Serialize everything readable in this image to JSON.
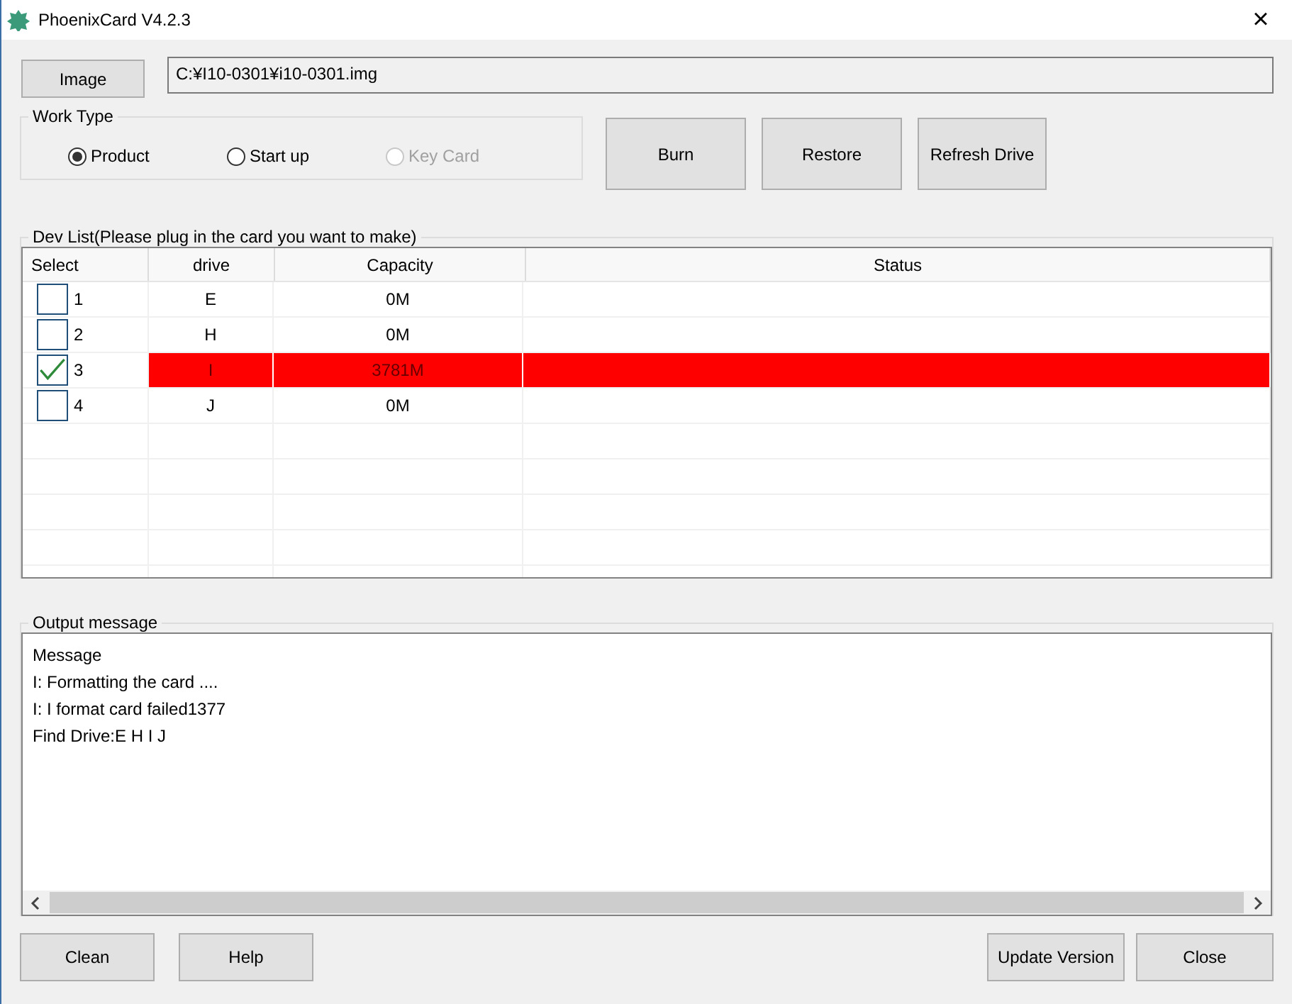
{
  "window": {
    "title": "PhoenixCard V4.2.3",
    "close": "×"
  },
  "image_button": "Image",
  "image_path": "C:¥I10-0301¥i10-0301.img",
  "work_type": {
    "label": "Work Type",
    "options": [
      {
        "label": "Product",
        "selected": true,
        "disabled": false
      },
      {
        "label": "Start up",
        "selected": false,
        "disabled": false
      },
      {
        "label": "Key Card",
        "selected": false,
        "disabled": true
      }
    ]
  },
  "actions": [
    "Burn",
    "Restore",
    "Refresh Drive"
  ],
  "dev_list": {
    "label": "Dev List(Please plug in the card you want to make)",
    "columns": [
      "Select",
      "drive",
      "Capacity",
      "Status"
    ],
    "rows": [
      {
        "index": "1",
        "checked": false,
        "highlighted": false,
        "drive": "E",
        "capacity": "0M"
      },
      {
        "index": "2",
        "checked": false,
        "highlighted": false,
        "drive": "H",
        "capacity": "0M"
      },
      {
        "index": "3",
        "checked": true,
        "highlighted": true,
        "drive": "I",
        "capacity": "3781M"
      },
      {
        "index": "4",
        "checked": false,
        "highlighted": false,
        "drive": "J",
        "capacity": "0M"
      }
    ]
  },
  "output": {
    "label": "Output message",
    "header": "Message",
    "lines": [
      "I: Formatting the card ....",
      "I: I format card failed1377",
      "Find Drive:E H I J"
    ]
  },
  "bottom_left": [
    "Clean",
    "Help"
  ],
  "bottom_right": [
    "Update Version",
    "Close"
  ]
}
